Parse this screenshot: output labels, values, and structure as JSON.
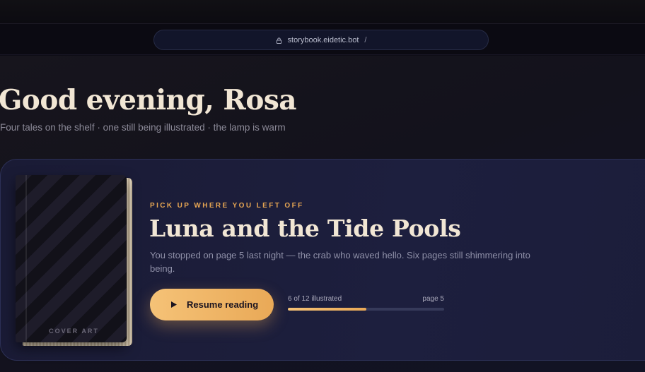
{
  "browser": {
    "url": "storybook.eidetic.bot",
    "path": "/"
  },
  "header": {
    "greeting": "Good evening, Rosa",
    "subtitle": "Four tales on the shelf · one still being illustrated · the lamp is warm"
  },
  "current_story": {
    "eyebrow": "PICK UP WHERE YOU LEFT OFF",
    "title": "Luna and the Tide Pools",
    "description": "You stopped on page 5 last night — the crab who waved hello. Six pages still shimmering into being.",
    "cover_label": "COVER ART",
    "resume_label": "Resume reading",
    "progress_label": "6 of 12 illustrated",
    "page_label": "page 5",
    "illustrated_done": 6,
    "illustrated_total": 12
  },
  "colors": {
    "accent": "#e9a957",
    "text": "#f1e6d4"
  },
  "icons": {
    "lock": "lock-icon",
    "play": "play-icon"
  }
}
